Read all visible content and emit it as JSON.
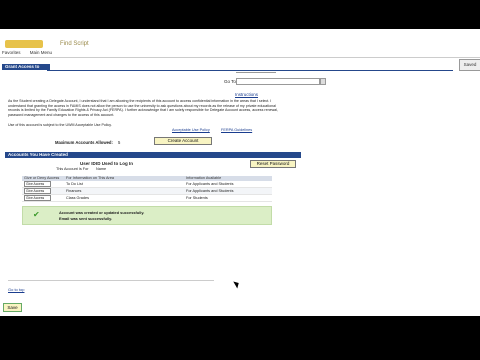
{
  "topbar": {
    "logo_text": "Find Script",
    "links": [
      "Favorites",
      "Main Menu"
    ]
  },
  "section_grant": {
    "title": "Grant Access to Others",
    "saved_label": "Saved",
    "go_to_label": "Go To:",
    "instructions_link": "Instructions",
    "paragraph": "As the Student creating a Delegate Account, I understand that I am allowing the recipients of this account to access confidential information in the areas that I select. I understand that granting the access in FAMIS does not allow the person to use the university to ask questions about my records as the release of my private educational records is limited by the Family Education Rights & Privacy Act (FERPA). I further acknowledge that I am solely responsible for Delegate Account access, access renewal, password management and changes to the access of this account.",
    "policy_line": "Use of this account is subject to the UWM Acceptable Use Policy.",
    "acceptable_use_link": "Acceptable Use Policy",
    "ferpa_link": "FERPA Guidelines",
    "max_accounts_label": "Maximum Accounts Allowed:",
    "max_accounts_value": "5",
    "create_button": "Create Account"
  },
  "section_accounts": {
    "title": "Accounts You Have Created",
    "reset_button": "Reset Password",
    "user_id_label": "User ID",
    "user_id_value": "ID Used to Log In",
    "account_for_label": "This Account Is For",
    "account_for_value": "Name",
    "grid_headers": [
      "Give or Deny Access",
      "For Information on This Area",
      "Information Available"
    ],
    "rows": [
      {
        "access": "Give Access",
        "area": "To Do List",
        "available": "For Applicants and Students"
      },
      {
        "access": "Give Access",
        "area": "Finances",
        "available": "For Applicants and Students"
      },
      {
        "access": "Give Access",
        "area": "Class Grades",
        "available": "For Students"
      }
    ],
    "success_line1": "Account was created or updated successfully.",
    "success_line2": "Email was sent successfully."
  },
  "footer": {
    "go_top_label": "Go to top",
    "save_button": "Save"
  }
}
